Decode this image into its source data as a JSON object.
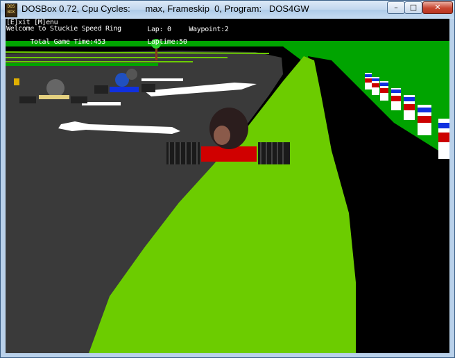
{
  "window": {
    "title": "DOSBox 0.72, Cpu Cycles:      max, Frameskip  0, Program:   DOS4GW",
    "icon": "dosbox-icon",
    "icon_text": "DOS BOX",
    "minimize_label": "–",
    "maximize_label": "□",
    "close_label": "✕"
  },
  "hud": {
    "menu_hint": "[E]xit [M]enu",
    "welcome": "Welcome to Stuckie Speed Ring",
    "lap_label": "Lap:",
    "lap_value": "0",
    "waypoint_label": "Waypoint:",
    "waypoint_value": "2",
    "total_time_label": "Total Game Time:",
    "total_time_value": "453",
    "laptime_label": "Laptime:",
    "laptime_value": "50"
  },
  "colors": {
    "grass_dark": "#00a400",
    "grass_light": "#6ccc00",
    "track": "#3a3a3a",
    "sky": "#000000",
    "kart_red": "#d00000",
    "kart_blue": "#1030e0"
  }
}
